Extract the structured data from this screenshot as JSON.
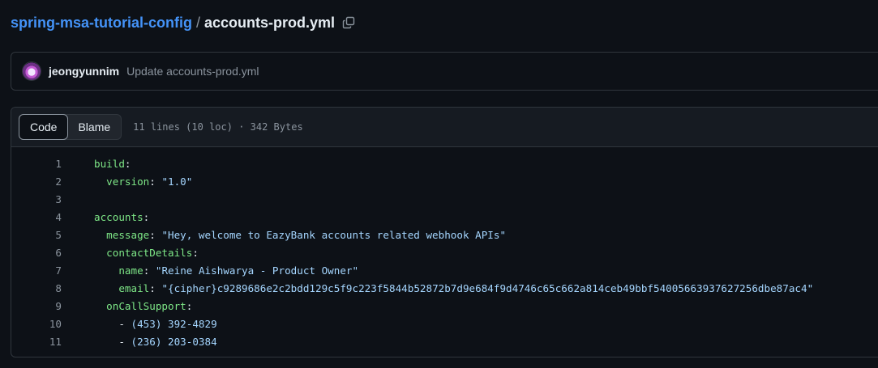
{
  "breadcrumb": {
    "repo": "spring-msa-tutorial-config",
    "separator": "/",
    "file": "accounts-prod.yml",
    "copy_icon": "copy-icon"
  },
  "commit": {
    "author": "jeongyunnim",
    "message": "Update accounts-prod.yml"
  },
  "file_header": {
    "tabs": [
      {
        "label": "Code",
        "active": true
      },
      {
        "label": "Blame",
        "active": false
      }
    ],
    "meta": "11 lines (10 loc) · 342 Bytes"
  },
  "code": {
    "lines": [
      {
        "n": "1",
        "indent": "",
        "key": "build",
        "value": "",
        "dash": ""
      },
      {
        "n": "2",
        "indent": "  ",
        "key": "version",
        "value": "\"1.0\"",
        "dash": ""
      },
      {
        "n": "3",
        "indent": "",
        "key": "",
        "value": "",
        "dash": ""
      },
      {
        "n": "4",
        "indent": "",
        "key": "accounts",
        "value": "",
        "dash": ""
      },
      {
        "n": "5",
        "indent": "  ",
        "key": "message",
        "value": "\"Hey, welcome to EazyBank accounts related webhook APIs\"",
        "dash": ""
      },
      {
        "n": "6",
        "indent": "  ",
        "key": "contactDetails",
        "value": "",
        "dash": ""
      },
      {
        "n": "7",
        "indent": "    ",
        "key": "name",
        "value": "\"Reine Aishwarya - Product Owner\"",
        "dash": ""
      },
      {
        "n": "8",
        "indent": "    ",
        "key": "email",
        "value": "\"{cipher}c9289686e2c2bdd129c5f9c223f5844b52872b7d9e684f9d4746c65c662a814ceb49bbf54005663937627256dbe87ac4\"",
        "dash": ""
      },
      {
        "n": "9",
        "indent": "  ",
        "key": "onCallSupport",
        "value": "",
        "dash": ""
      },
      {
        "n": "10",
        "indent": "    ",
        "key": "",
        "value": "(453) 392-4829",
        "dash": "- "
      },
      {
        "n": "11",
        "indent": "    ",
        "key": "",
        "value": "(236) 203-0384",
        "dash": "- "
      }
    ]
  }
}
